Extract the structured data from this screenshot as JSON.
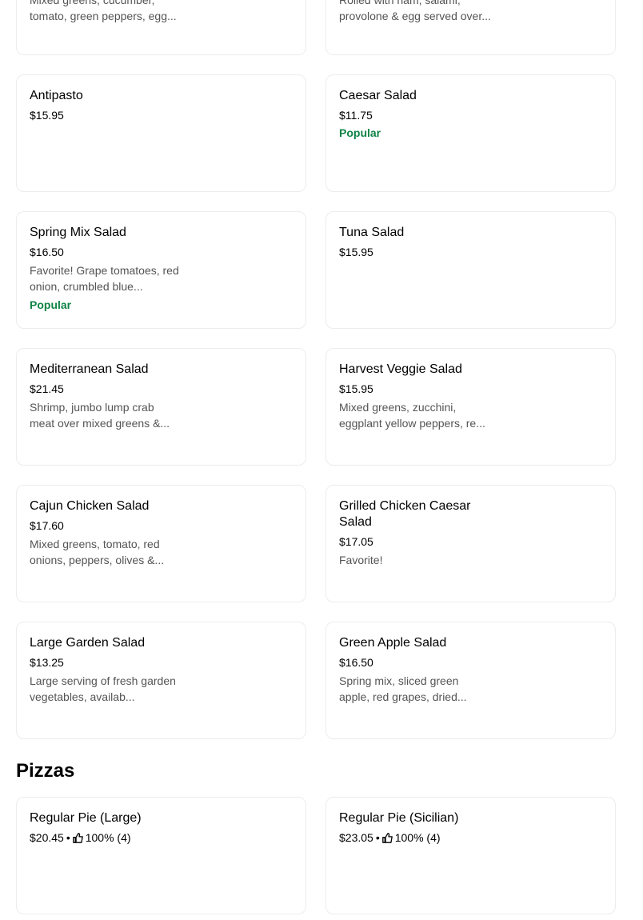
{
  "top_cards": [
    {
      "desc": "Mixed greens, cucumber, tomato, green peppers, egg..."
    },
    {
      "desc": "Rolled with ham, salami, provolone & egg served over..."
    }
  ],
  "salad_items": [
    {
      "title": "Antipasto",
      "price": "$15.95"
    },
    {
      "title": "Caesar Salad",
      "price": "$11.75",
      "badge": "Popular"
    },
    {
      "title": "Spring Mix Salad",
      "price": "$16.50",
      "desc": "Favorite! Grape tomatoes, red onion, crumbled blue...",
      "badge": "Popular"
    },
    {
      "title": "Tuna Salad",
      "price": "$15.95"
    },
    {
      "title": "Mediterranean Salad",
      "price": "$21.45",
      "desc": "Shrimp, jumbo lump crab meat over mixed greens &..."
    },
    {
      "title": "Harvest Veggie Salad",
      "price": "$15.95",
      "desc": "Mixed greens, zucchini, eggplant yellow peppers, re..."
    },
    {
      "title": "Cajun Chicken Salad",
      "price": "$17.60",
      "desc": "Mixed greens, tomato, red onions, peppers, olives &..."
    },
    {
      "title": "Grilled Chicken Caesar Salad",
      "price": "$17.05",
      "desc": "Favorite!"
    },
    {
      "title": "Large Garden Salad",
      "price": "$13.25",
      "desc": "Large serving of fresh garden vegetables, availab..."
    },
    {
      "title": "Green Apple Salad",
      "price": "$16.50",
      "desc": "Spring mix, sliced green apple, red grapes, dried..."
    }
  ],
  "pizzas_section": {
    "title": "Pizzas",
    "items": [
      {
        "title": "Regular Pie (Large)",
        "price": "$20.45",
        "separator": "•",
        "rating": "100% (4)"
      },
      {
        "title": "Regular Pie (Sicilian)",
        "price": "$23.05",
        "separator": "•",
        "rating": "100% (4)"
      }
    ]
  },
  "colors": {
    "accent_green": "#0e8345",
    "muted_text": "#545454",
    "border": "#ececec"
  },
  "icons": {
    "rating": "thumbs-up-icon"
  }
}
